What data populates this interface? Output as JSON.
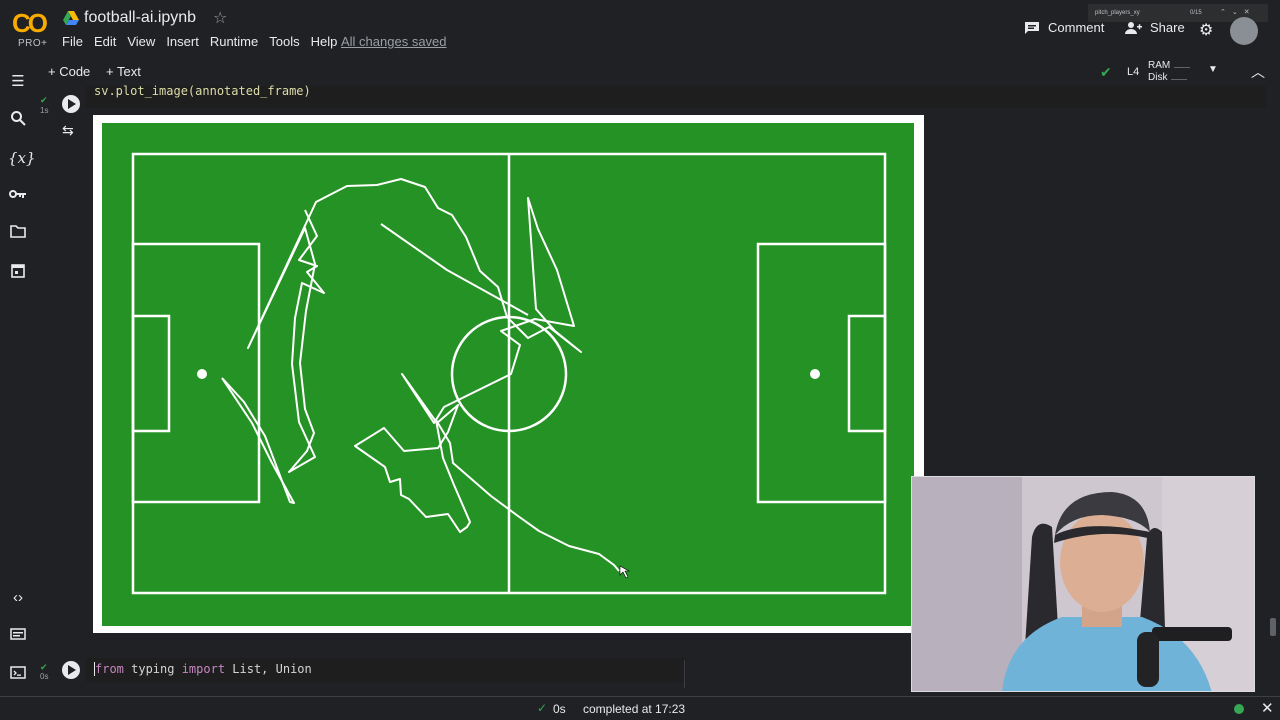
{
  "header": {
    "logo_text": "CO",
    "logo_badge": "PRO+",
    "notebook_title": "football-ai.ipynb",
    "menu": [
      "File",
      "Edit",
      "View",
      "Insert",
      "Runtime",
      "Tools",
      "Help"
    ],
    "save_status": "All changes saved",
    "comment_label": "Comment",
    "share_label": "Share",
    "find_query": "pitch_players_xy",
    "find_count": "0/15"
  },
  "toolbar": {
    "add_code_label": "+ Code",
    "add_text_label": "+ Text",
    "runtime_type": "L4",
    "ram_label": "RAM",
    "disk_label": "Disk"
  },
  "cells": [
    {
      "exec_time": "1s",
      "code": "sv.plot_image(annotated_frame)"
    },
    {
      "exec_time": "0s",
      "code_kw1": "from",
      "code_mod": " typing ",
      "code_kw2": "import",
      "code_rest": " List, Union"
    }
  ],
  "plot": {
    "pitch_color": "#259225",
    "line_color": "#ffffff"
  },
  "status": {
    "seconds": "0s",
    "completed_text": "completed at 17:23"
  },
  "icons": {
    "sidebar": [
      "toc-icon",
      "search-icon",
      "variables-icon",
      "key-icon",
      "folder-icon",
      "calendar-icon",
      "code-snippets-icon",
      "command-palette-icon",
      "terminal-icon"
    ]
  }
}
